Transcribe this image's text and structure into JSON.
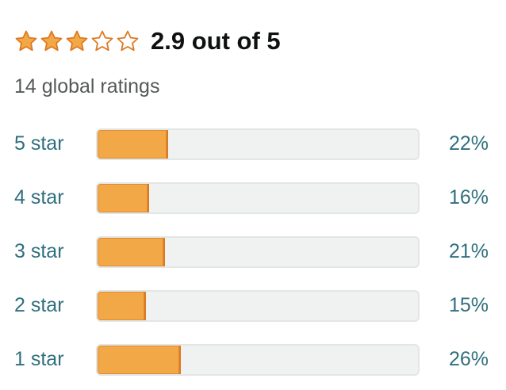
{
  "summary": {
    "average": 2.9,
    "rating_text": "2.9 out of 5",
    "star_icons": [
      "star-filled-icon",
      "star-filled-icon",
      "star-filled-icon",
      "star-empty-icon",
      "star-empty-icon"
    ],
    "filled_star_color": "#f3a847",
    "star_outline_color": "#de7921"
  },
  "global_ratings": {
    "text": "14 global ratings"
  },
  "histogram": {
    "rows": [
      {
        "label": "5 star",
        "percent_text": "22%",
        "percent": 22
      },
      {
        "label": "4 star",
        "percent_text": "16%",
        "percent": 16
      },
      {
        "label": "3 star",
        "percent_text": "21%",
        "percent": 21
      },
      {
        "label": "2 star",
        "percent_text": "15%",
        "percent": 15
      },
      {
        "label": "1 star",
        "percent_text": "26%",
        "percent": 26
      }
    ],
    "bar_color": "#f3a847",
    "track_color": "#f0f2f2",
    "link_color": "#2f6f7e"
  }
}
